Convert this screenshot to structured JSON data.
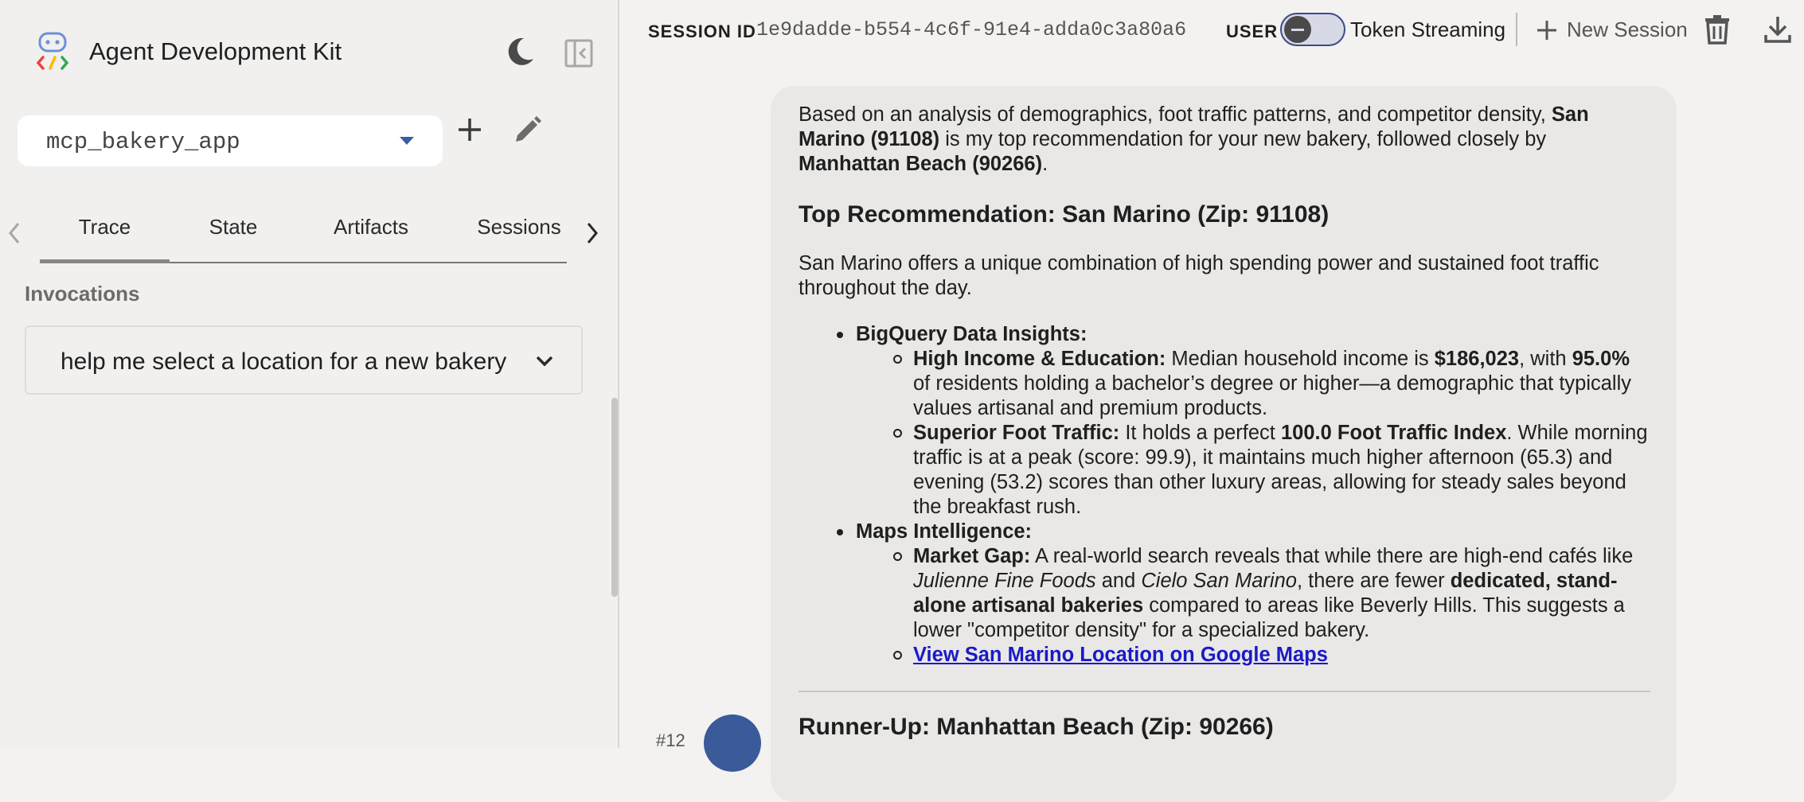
{
  "sidebar": {
    "title": "Agent Development Kit",
    "app_select": {
      "value": "mcp_bakery_app"
    },
    "tabs": [
      {
        "label": "Trace",
        "active": true
      },
      {
        "label": "State",
        "active": false
      },
      {
        "label": "Artifacts",
        "active": false
      },
      {
        "label": "Sessions",
        "active": false
      }
    ],
    "invocations_label": "Invocations",
    "invocation": "help me select a location for a new bakery"
  },
  "header": {
    "session_label": "SESSION ID",
    "session_id": "1e9dadde-b554-4c6f-91e4-adda0c3a80a6",
    "user_label": "USER I",
    "token_streaming_label": "Token Streaming",
    "token_streaming_on": false,
    "new_session_label": "New Session"
  },
  "chat": {
    "message_index": "#12",
    "intro": {
      "p1": "Based on an analysis of demographics, foot traffic patterns, and competitor density, ",
      "b1": "San Marino (91108)",
      "p2": " is my top recommendation for your new bakery, followed closely by ",
      "b2": "Manhattan Beach (90266)",
      "p3": "."
    },
    "top_heading": "Top Recommendation: San Marino (Zip: 91108)",
    "top_summary": "San Marino offers a unique combination of high spending power and sustained foot traffic throughout the day.",
    "bq_heading": "BigQuery Data Insights:",
    "bq_income": {
      "label": "High Income & Education:",
      "t1": " Median household income is ",
      "b1": "$186,023",
      "t2": ", with ",
      "b2": "95.0%",
      "t3": " of residents holding a bachelor’s degree or higher—a demographic that typically values artisanal and premium products."
    },
    "bq_traffic": {
      "label": "Superior Foot Traffic:",
      "t1": " It holds a perfect ",
      "b1": "100.0 Foot Traffic Index",
      "t2": ". While morning traffic is at a peak (score: 99.9), it maintains much higher afternoon (65.3) and evening (53.2) scores than other luxury areas, allowing for steady sales beyond the breakfast rush."
    },
    "maps_heading": "Maps Intelligence:",
    "maps_gap": {
      "label": "Market Gap:",
      "t1": " A real-world search reveals that while there are high-end cafés like ",
      "i1": "Julienne Fine Foods",
      "t2": " and ",
      "i2": "Cielo San Marino",
      "t3": ", there are fewer ",
      "b1": "dedicated, stand-alone artisanal bakeries",
      "t4": " compared to areas like Beverly Hills. This suggests a lower \"competitor density\" for a specialized bakery."
    },
    "maps_link": "View San Marino Location on Google Maps",
    "runner_heading": "Runner-Up: Manhattan Beach (Zip: 90266)"
  },
  "colors": {
    "accent": "#3b5ba5",
    "link": "#1a1ac8",
    "bubble": "#e9e8e6",
    "sidebar_bg": "#f1f0ef"
  },
  "icons": [
    "adk-logo-icon",
    "moon-icon",
    "sidebar-collapse-icon",
    "dropdown-caret-icon",
    "plus-icon",
    "pencil-icon",
    "chevron-left-icon",
    "chevron-right-icon",
    "chevron-down-icon",
    "trash-icon",
    "download-icon",
    "bot-avatar-icon"
  ]
}
